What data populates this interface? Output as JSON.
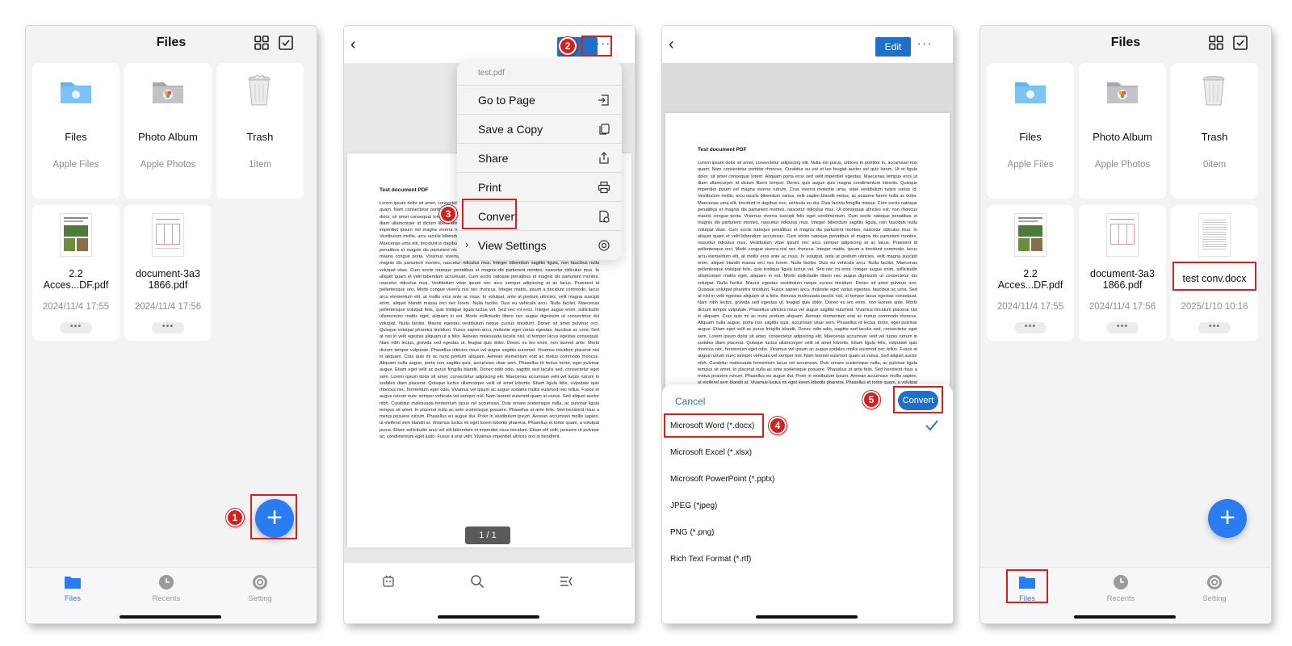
{
  "colors": {
    "accent": "#2a7df0",
    "button_blue": "#1f70c8",
    "highlight": "#d62020",
    "folder_blue": "#5fb4f3",
    "tab_inactive": "#9a9a9f"
  },
  "screen1": {
    "title": "Files",
    "tiles": [
      {
        "name": "Files",
        "sub": "Apple Files",
        "icon": "blue-folder-icon"
      },
      {
        "name": "Photo Album",
        "sub": "Apple Photos",
        "icon": "photos-folder-icon"
      },
      {
        "name": "Trash",
        "sub": "1item",
        "icon": "trash-icon"
      }
    ],
    "files": [
      {
        "name": "2.2 Acces...DF.pdf",
        "date": "2024/11/4 17:55",
        "more": "•••"
      },
      {
        "name": "document-3a3 1866.pdf",
        "date": "2024/11/4 17:56",
        "more": "•••"
      }
    ],
    "fab_symbol": "+",
    "step": "1"
  },
  "tabs": [
    {
      "label": "Files",
      "icon": "folder-tab-icon"
    },
    {
      "label": "Recents",
      "icon": "clock-icon"
    },
    {
      "label": "Setting",
      "icon": "gear-icon"
    }
  ],
  "screen2": {
    "dots": "···",
    "menu": {
      "file": "test.pdf",
      "items": [
        {
          "label": "Go to Page",
          "icon": "go-to-page-icon"
        },
        {
          "label": "Save a Copy",
          "icon": "copy-icon"
        },
        {
          "label": "Share",
          "icon": "share-icon"
        },
        {
          "label": "Print",
          "icon": "printer-icon"
        },
        {
          "label": "Convert",
          "icon": "convert-icon"
        },
        {
          "label": "View Settings",
          "icon": "settings-icon",
          "chevron": "›"
        }
      ]
    },
    "page_indicator": "1 / 1",
    "steps": [
      "2",
      "3"
    ]
  },
  "document": {
    "title": "Test document PDF",
    "body": "Lorem ipsum dolor sit amet, consectetur adipiscing elit. Nulla est purus, ultrices in porttitor in, accumsan non quam. Nam consectetur porttitor rhoncus. Curabitur eu est et leo feugiat auctor vel quis lorem. Ut et ligula dolor, sit amet consequat lorem. Aliquam porta eros sed velit imperdiet egestas. Maecenas tempus eros ut diam ullamcorper id dictum libero tempor. Donec quis augue quis magna condimentum lobortis. Quisque imperdiet ipsum vel magna viverra rutrum. Cras viverra molestie urna, vitae vestibulum turpis varius id. Vestibulum mollis, arcu iaculis bibendum varius, velit sapien blandit metus, ac posuere lorem nulla ac dolor. Maecenas urna elit, tincidunt in dapibus nec, vehicula eu dui. Duis lacinia fringilla massa. Cum sociis natoque penatibus et magnis dis parturient montes, nascetur ridiculus mus. Ut consequat ultricies est, non rhoncus mauris congue porta. Vivamus viverra suscipit felis eget condimentum. Cum sociis natoque penatibus et magnis dis parturient montes, nascetur ridiculus mus. Integer bibendum sagittis ligula, non faucibus nulla volutpat vitae. Cum sociis natoque penatibus et magnis dis parturient montes, nascetur ridiculus mus. In aliquet quam et velit bibendum accumsan. Cum sociis natoque penatibus et magnis dis parturient montes, nascetur ridiculus mus. Vestibulum vitae ipsum nec arcu semper adipiscing at ac lacus. Praesent id pellentesque orci. Morbi congue viverra nisl nec rhoncus. Integer mattis, ipsum a tincidunt commodo, lacus arcu elementum elit, at mollis eros ante ac risus. In volutpat, ante at pretium ultricies, velit magna suscipit enim, aliquet blandit massa orci nec lorem. Nulla facilisi. Duis eu vehicula arcu. Nulla facilisi. Maecenas pellentesque volutpat felis, quis tristique ligula luctus vel. Sed nec mi eros. Integer augue enim, sollicitudin ullamcorper mattis eget, aliquam in est. Morbi sollicitudin libero nec augue dignissim ut consectetur dui volutpat. Nulla facilisi. Mauris egestas vestibulum neque cursus tincidunt. Donec sit amet pulvinar orci. Quisque volutpat pharetra tincidunt. Fusce sapien arcu, molestie eget varius egestas, faucibus ac urna. Sed at nisi in velit egestas aliquam ut a felis. Aenean malesuada iaculis nisl, ut tempor lacus egestas consequat. Nam nibh lectus, gravida sed egestas ut, feugiat quis dolor. Donec eu leo enim, non laoreet ante. Morbi dictum tempor vulputate. Phasellus ultricies risus vel augue sagittis euismod. Vivamus tincidunt placerat nisi in aliquam. Cras quis mi ac nunc pretium aliquam. Aenean elementum erat ac metus commodo rhoncus. Aliquam nulla augue, porta non sagittis quis, accumsan vitae sem. Phasellus id lectus tortor, eget pulvinar augue. Etiam eget velit ac purus fringilla blandit. Donec odio odio, sagittis sed iaculis sed, consectetur eget sem. Lorem ipsum dolor sit amet, consectetur adipiscing elit. Maecenas accumsan velit vel turpis rutrum in sodales diam placerat. Quisque luctus ullamcorper velit sit amet lobortis. Etiam ligula felis, vulputate quis rhoncus nec, fermentum eget odio. Vivamus vel ipsum ac augue sodales mollis euismod nec tellus. Fusce et augue rutrum nunc semper vehicula vel semper nisl. Nam laoreet euismod quam at varius. Sed aliquet auctor nibh. Curabitur malesuada fermentum lacus vel accumsan. Duis ornare scelerisque nulla, ac pulvinar ligula tempus sit amet. In placerat nulla ac ante scelerisque posuere. Phasellus at ante felis. Sed hendrerit risus a metus posuere rutrum. Phasellus eu augue dui. Proin in vestibulum ipsum. Aenean accumsan mollis sapien, ut eleifend sem blandit at. Vivamus luctus mi eget lorem lobortis pharetra. Phasellus et tortor quam, a volutpat purus. Etiam sollicitudin arcu vel elit bibendum et imperdiet risus tincidunt. Etiam elit velit, posuere ut pulvinar ac, condimentum eget justo. Fusce a erat velit. Vivamus imperdiet ultrices orci in hendrerit."
  },
  "screen3": {
    "edit": "Edit",
    "dots": "···",
    "cancel": "Cancel",
    "convert": "Convert",
    "formats": [
      "Microsoft Word (*.docx)",
      "Microsoft Excel (*.xlsx)",
      "Microsoft PowerPoint (*.pptx)",
      "JPEG (*jpeg)",
      "PNG (*.png)",
      "Rich Text Format (*.rtf)"
    ],
    "selected_format_index": 0,
    "steps": [
      "4",
      "5"
    ]
  },
  "screen4": {
    "title": "Files",
    "tiles": [
      {
        "name": "Files",
        "sub": "Apple Files",
        "icon": "blue-folder-icon"
      },
      {
        "name": "Photo Album",
        "sub": "Apple Photos",
        "icon": "photos-folder-icon"
      },
      {
        "name": "Trash",
        "sub": "0item",
        "icon": "trash-icon"
      }
    ],
    "files": [
      {
        "name": "2.2 Acces...DF.pdf",
        "date": "2024/11/4 17:55",
        "more": "•••"
      },
      {
        "name": "document-3a3 1866.pdf",
        "date": "2024/11/4 17:56",
        "more": "•••"
      },
      {
        "name": "test conv.docx",
        "date": "2025/1/10 10:16",
        "more": "•••"
      }
    ],
    "fab_symbol": "+"
  }
}
